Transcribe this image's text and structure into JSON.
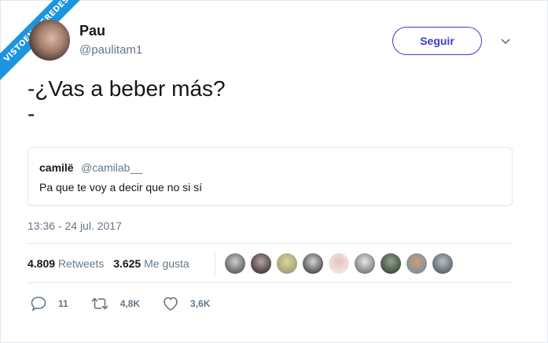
{
  "watermark": "VISTOENLASREDES",
  "author": {
    "name": "Pau",
    "handle": "@paulitam1"
  },
  "follow_label": "Seguir",
  "tweet": {
    "text": "-¿Vas a beber más?\n-"
  },
  "quoted": {
    "name": "camilë",
    "handle": "@camilab__",
    "text": "Pa que te voy a decir que no si sí"
  },
  "timestamp": "13:36 - 24 jul. 2017",
  "stats": {
    "retweets_value": "4.809",
    "retweets_label": "Retweets",
    "likes_value": "3.625",
    "likes_label": "Me gusta"
  },
  "actions": {
    "replies": "11",
    "retweets": "4,8K",
    "likes": "3,6K"
  },
  "colors": {
    "accent": "#3b3bd4",
    "muted": "#657786",
    "border": "#e1e8ed",
    "ribbon": "#1b95e0"
  },
  "icons": [
    "caret-down-icon",
    "reply-icon",
    "retweet-icon",
    "heart-icon"
  ]
}
